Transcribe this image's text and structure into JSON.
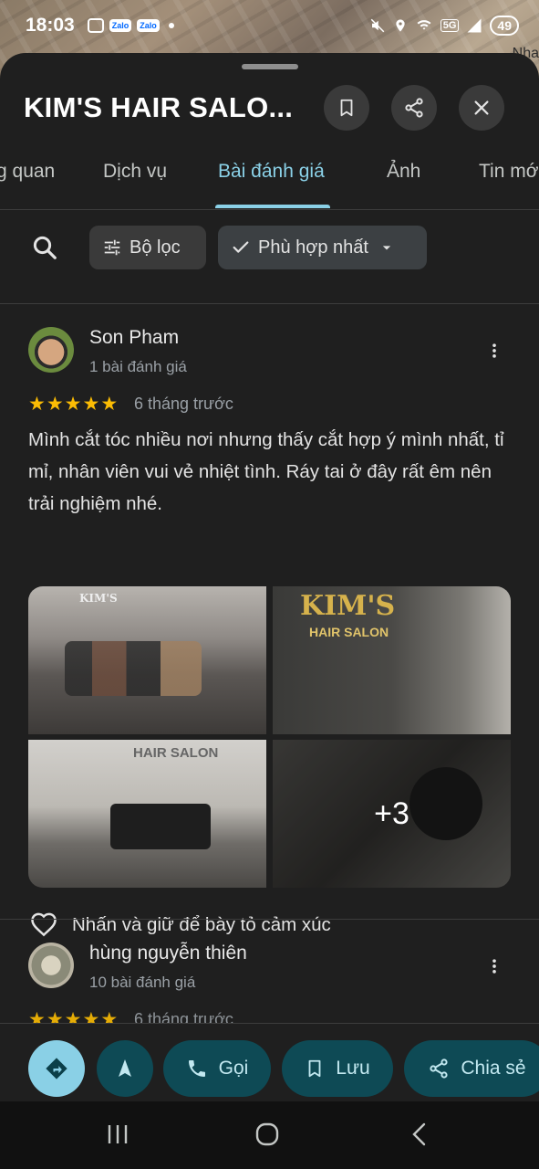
{
  "status_bar": {
    "time": "18:03",
    "zalo_1": "Zalo",
    "zalo_2": "Zalo",
    "network": "5G",
    "battery": "49"
  },
  "map": {
    "label": "Nha"
  },
  "header": {
    "title": "KIM'S HAIR SALO...",
    "icons": [
      "bookmark-icon",
      "share-icon",
      "close-icon"
    ]
  },
  "tabs": [
    {
      "label": "g quan"
    },
    {
      "label": "Dịch vụ"
    },
    {
      "label": "Bài đánh giá",
      "active": true
    },
    {
      "label": "Ảnh"
    },
    {
      "label": "Tin mớ"
    }
  ],
  "filters": {
    "filter_label": "Bộ lọc",
    "sort_label": "Phù hợp nhất"
  },
  "reviews": [
    {
      "name": "Son Pham",
      "count": "1 bài đánh giá",
      "rating": 5,
      "time": "6 tháng trước",
      "text": "Mình cắt tóc nhiều nơi nhưng thấy cắt hợp ý mình nhất, tỉ mỉ, nhân viên vui vẻ nhiệt tình.  Ráy tai ở đây rất êm nên trải nghiệm nhé.",
      "photos": {
        "logo_text": "KIM'S",
        "logo_sub": "HAIR SALON",
        "logo_mini": "KIM'S",
        "sign_text": "HAIR SALON",
        "more_count": "+3"
      },
      "reaction_hint": "Nhấn và giữ để bày tỏ cảm xúc"
    },
    {
      "name": "hùng nguyễn thiên",
      "count": "10 bài đánh giá",
      "rating": 5,
      "time": "6 tháng trước"
    }
  ],
  "actions": {
    "call": "Gọi",
    "save": "Lưu",
    "share": "Chia sẻ"
  },
  "colors": {
    "accent": "#8ad0e6",
    "star": "#fbbc04",
    "action_bg": "#0e4a55",
    "background": "#1f1f1f"
  }
}
